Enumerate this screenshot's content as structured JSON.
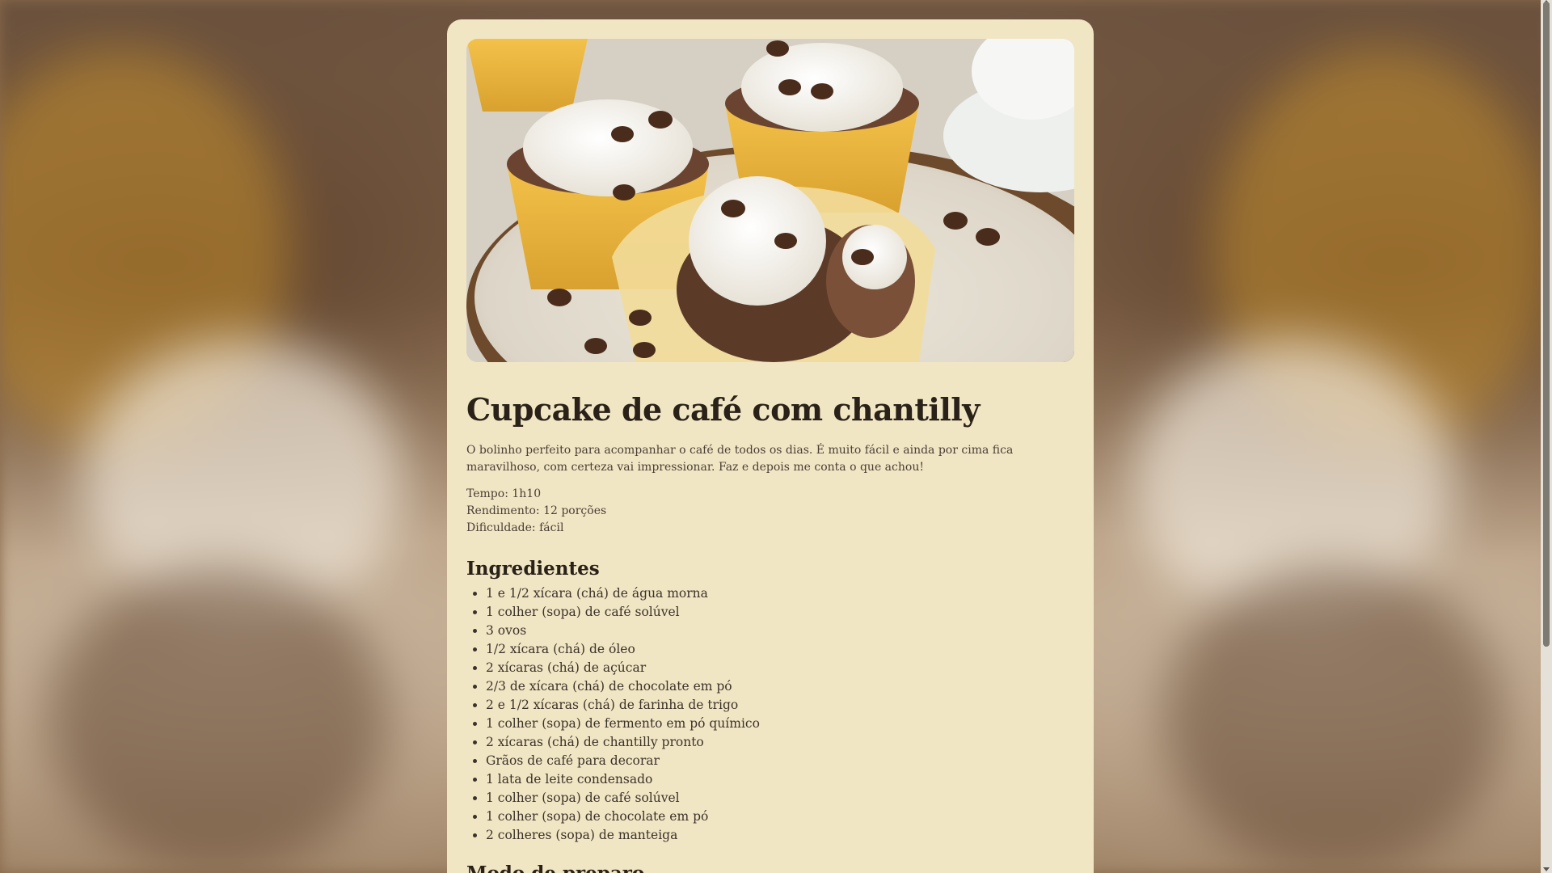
{
  "recipe": {
    "title": "Cupcake de café com chantilly",
    "description": "O bolinho perfeito para acompanhar o café de todos os dias. É muito fácil e ainda por cima fica maravilhoso, com certeza vai impressionar. Faz e depois me conta o que achou!",
    "time": "Tempo: 1h10",
    "yield": "Rendimento: 12 porções",
    "difficulty": "Dificuldade: fácil",
    "ingredients_heading": "Ingredientes",
    "ingredients": [
      "1 e 1/2 xícara (chá) de água morna",
      "1 colher (sopa) de café solúvel",
      "3 ovos",
      "1/2 xícara (chá) de óleo",
      "2 xícaras (chá) de açúcar",
      "2/3 de xícara (chá) de chocolate em pó",
      "2 e 1/2 xícaras (chá) de farinha de trigo",
      "1 colher (sopa) de fermento em pó químico",
      "2 xícaras (chá) de chantilly pronto",
      "Grãos de café para decorar",
      "1 lata de leite condensado",
      "1 colher (sopa) de café solúvel",
      "1 colher (sopa) de chocolate em pó",
      "2 colheres (sopa) de manteiga"
    ],
    "next_heading": "Modo de preparo"
  },
  "colors": {
    "card_background": "#f1e6c4",
    "heading": "#2a2118",
    "text": "#4a3f36"
  }
}
